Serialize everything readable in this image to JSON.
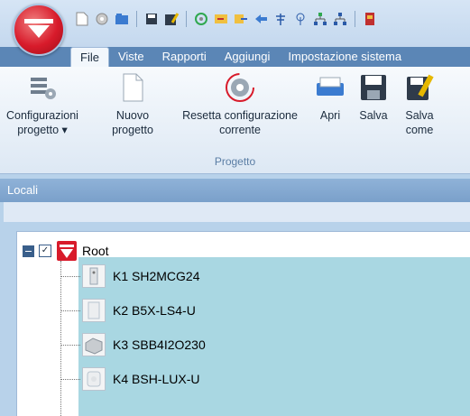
{
  "tabs": [
    "File",
    "Viste",
    "Rapporti",
    "Aggiungi",
    "Impostazione sistema"
  ],
  "ribbon": {
    "buttons": [
      {
        "line1": "Configurazioni",
        "line2": "progetto ▾"
      },
      {
        "line1": "Nuovo",
        "line2": "progetto"
      },
      {
        "line1": "Resetta configurazione",
        "line2": "corrente"
      },
      {
        "line1": "Apri",
        "line2": ""
      },
      {
        "line1": "Salva",
        "line2": ""
      },
      {
        "line1": "Salva",
        "line2": "come"
      }
    ],
    "group_label": "Progetto"
  },
  "panel": {
    "title": "Locali"
  },
  "tree": {
    "root": {
      "label": "Root",
      "checked": "✓"
    },
    "children": [
      {
        "label": "K1 SH2MCG24"
      },
      {
        "label": "K2 B5X-LS4-U"
      },
      {
        "label": "K3 SBB4I2O230"
      },
      {
        "label": "K4 BSH-LUX-U"
      }
    ]
  },
  "colors": {
    "brand_red": "#d81b2b",
    "ribbon_blue": "#5b86b6",
    "tree_selection": "#a9d7e2"
  }
}
